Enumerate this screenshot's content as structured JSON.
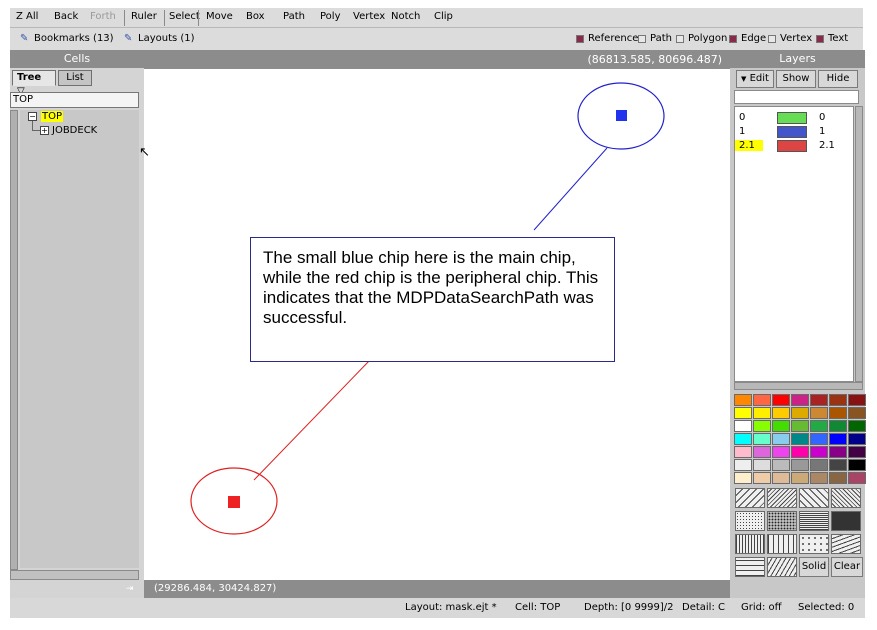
{
  "toolbar": {
    "items": [
      "Z All",
      "Back",
      "Forth",
      "Ruler",
      "Select",
      "Move",
      "Box",
      "Path",
      "Poly",
      "Vertex",
      "Notch",
      "Clip"
    ]
  },
  "bar2": {
    "bookmarks": "Bookmarks (13)",
    "layouts": "Layouts (1)",
    "legend": [
      {
        "label": "Reference",
        "color": "#8a2a4a"
      },
      {
        "label": "Path",
        "color": "#e8e8e8"
      },
      {
        "label": "Polygon",
        "color": "#e8e8e8"
      },
      {
        "label": "Edge",
        "color": "#8a2a4a"
      },
      {
        "label": "Vertex",
        "color": "#e8e8e8"
      },
      {
        "label": "Text",
        "color": "#8a2a4a"
      }
    ]
  },
  "cells": {
    "title": "Cells",
    "tab_tree": "Tree",
    "tab_list": "List",
    "input_value": "TOP",
    "tree": [
      "TOP",
      "JOBDECK"
    ]
  },
  "canvas": {
    "coords": "(86813.585, 80696.487)",
    "bottom_coords": "(29286.484, 30424.827)",
    "callout": "The small blue chip here is the main chip, while the red chip is the peripheral chip. This indicates that the MDPDataSearchPath was successful."
  },
  "layers": {
    "title": "Layers",
    "buttons": [
      "Edit",
      "Show",
      "Hide"
    ],
    "rows": [
      {
        "id": "0",
        "name": "0",
        "color": "#66dd55"
      },
      {
        "id": "1",
        "name": "1",
        "color": "#4455cc"
      },
      {
        "id": "2.1",
        "name": "2.1",
        "color": "#dd4444"
      }
    ],
    "solid_label": "Solid",
    "clear_label": "Clear"
  },
  "status": {
    "layout": "Layout: mask.ejt *",
    "cell": "Cell: TOP",
    "depth": "Depth: [0 9999]/2",
    "detail": "Detail: C",
    "grid": "Grid: off",
    "selected": "Selected: 0"
  },
  "colors": {
    "palette": [
      "#ff8800",
      "#ff6644",
      "#ff0000",
      "#cc2288",
      "#aa2222",
      "#993311",
      "#881111",
      "#ffff00",
      "#ffee00",
      "#ffcc00",
      "#ddaa00",
      "#cc8833",
      "#aa5500",
      "#885522",
      "#ffffff",
      "#88ff00",
      "#44dd00",
      "#66bb33",
      "#22aa44",
      "#118833",
      "#006600",
      "#00ffff",
      "#66ffcc",
      "#88ccee",
      "#008888",
      "#3366ff",
      "#0000ff",
      "#000088",
      "#ffbbcc",
      "#dd66dd",
      "#ee44ee",
      "#ff00aa",
      "#cc00cc",
      "#880088",
      "#440044",
      "#eeeeee",
      "#dddddd",
      "#bbbbbb",
      "#999999",
      "#777777",
      "#444444",
      "#000000",
      "#ffeecc",
      "#eeccaa",
      "#ddbb99",
      "#ccaa77",
      "#aa8866",
      "#886644",
      "#aa4466"
    ]
  }
}
